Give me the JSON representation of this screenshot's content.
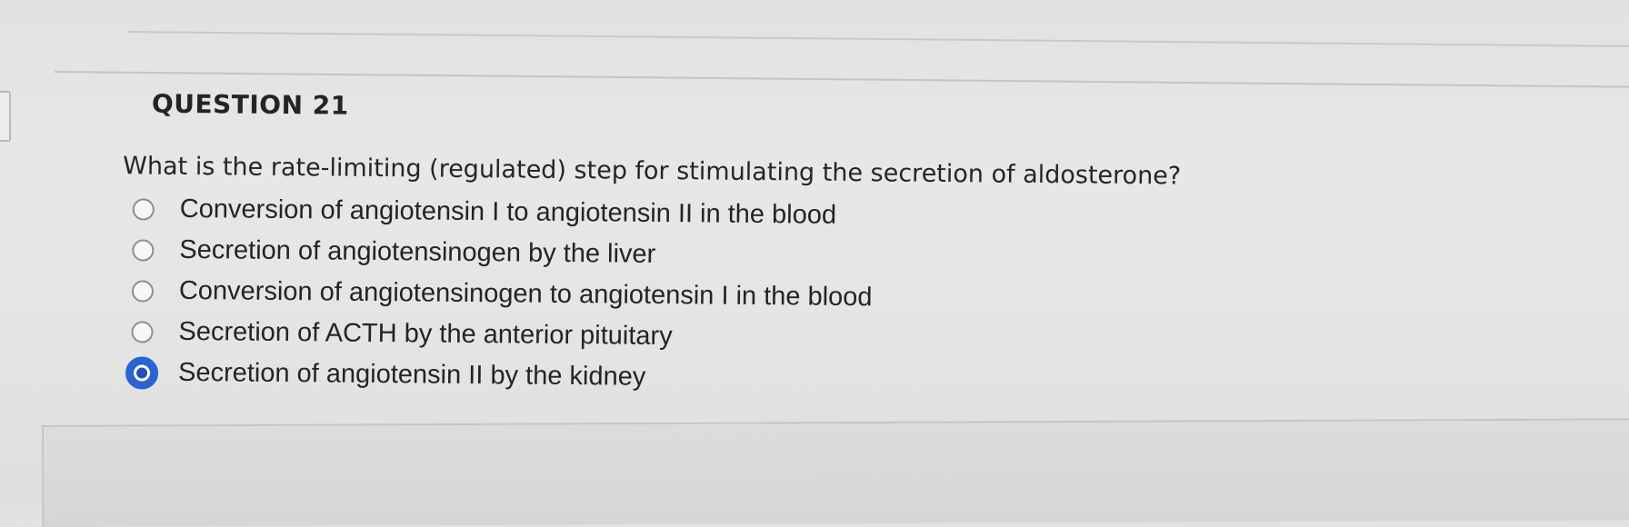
{
  "question": {
    "number_label": "QUESTION 21",
    "prompt": "What is the rate-limiting (regulated) step for stimulating the secretion of aldosterone?",
    "options": [
      {
        "label": "Conversion of angiotensin I to angiotensin II in the blood",
        "selected": false
      },
      {
        "label": "Secretion of angiotensinogen by the liver",
        "selected": false
      },
      {
        "label": "Conversion of angiotensinogen to angiotensin I in the blood",
        "selected": false
      },
      {
        "label": "Secretion of ACTH by the anterior pituitary",
        "selected": false
      },
      {
        "label": "Secretion of angiotensin II by the kidney",
        "selected": true
      }
    ]
  },
  "colors": {
    "selected_radio": "#2a63d6",
    "background": "#e5e5e4",
    "text": "#242424"
  }
}
